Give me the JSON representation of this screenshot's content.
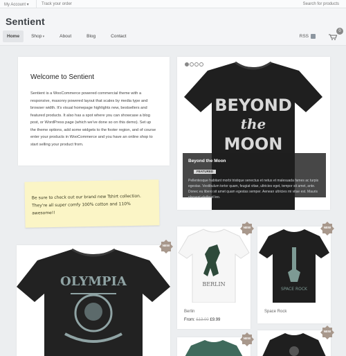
{
  "topbar": {
    "account": "My Account ▾",
    "track": "Track your order",
    "search": "Search for products"
  },
  "header": {
    "logo": "Sentient",
    "rss": "RSS",
    "cart_icon": "cart-icon",
    "cart_count": "0"
  },
  "nav": {
    "items": [
      "Home",
      "Shop",
      "About",
      "Blog",
      "Contact"
    ],
    "active": "Home"
  },
  "welcome": {
    "title": "Welcome to Sentient",
    "body": "Sentient is a WooCommerce powered commercial theme with a responsive, masonry powered layout that scales by media type and browser width. It's visual homepage highlights new, bestsellers and featured products. It also has a spot where you can showcase a blog post, or WordPress page (which we've done so on this demo). Set up the theme options, add some widgets to the footer region, and of course enter your products in WooCommerce and you have an online shop to start selling your product from."
  },
  "slider": {
    "dots": 4,
    "active_dot": 1,
    "shirt_text": [
      "BEYOND",
      "the",
      "MOON"
    ],
    "caption_title": "Beyond the Moon",
    "caption_tag": "FEATURED",
    "caption_text": "Pellentesque habitant morbi tristique senectus et netus et malesuada fames ac turpis egestas. Vestibulum tortor quam, feugiat vitae, ultricies eget, tempor sit amet, ante. Donec eu libero sit amet quam egestas semper. Aenean ultricies mi vitae est. Mauris placerat eleifend leo."
  },
  "note": {
    "text": "Be sure to check out our brand new  Tshirt collection. They're all super comfy 100% cotton and 110% awesome!!"
  },
  "badge_label": "NEW",
  "products": [
    {
      "name": "",
      "print": "OLYMPIA"
    },
    {
      "name": "Berlin",
      "price_label": "From:",
      "old_price": "£13.00",
      "price": "£9.99",
      "print": "BERLIN"
    },
    {
      "name": "Space Rock",
      "print": "SPACE ROCK"
    },
    {
      "name": ""
    },
    {
      "name": ""
    }
  ],
  "colors": {
    "accent": "#a8988c",
    "shirt_dark": "#1f1f1f",
    "background": "#eceef0"
  }
}
